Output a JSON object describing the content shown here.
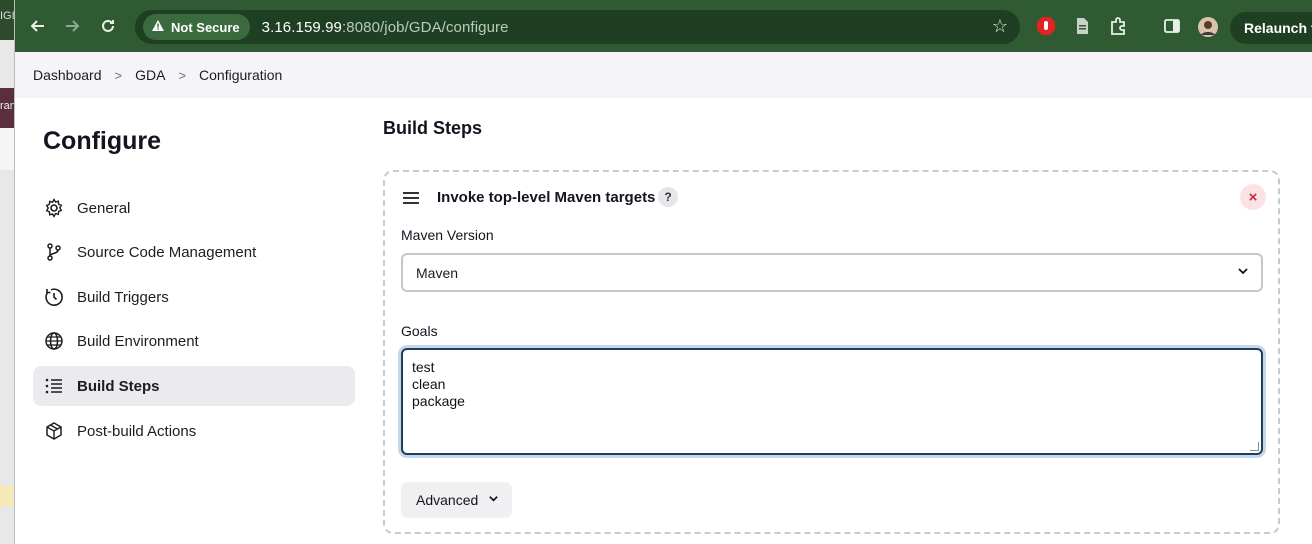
{
  "background_window": {
    "fragment_top": "IGI",
    "fragment_mid": "ran"
  },
  "browser": {
    "security_label": "Not Secure",
    "url_host": "3.16.159.99",
    "url_rest": ":8080/job/GDA/configure",
    "relaunch_label": "Relaunch to"
  },
  "breadcrumb": {
    "items": [
      "Dashboard",
      "GDA",
      "Configuration"
    ],
    "separator": ">"
  },
  "sidebar": {
    "title": "Configure",
    "items": [
      {
        "label": "General",
        "icon": "gear-icon"
      },
      {
        "label": "Source Code Management",
        "icon": "branch-icon"
      },
      {
        "label": "Build Triggers",
        "icon": "timer-icon"
      },
      {
        "label": "Build Environment",
        "icon": "globe-icon"
      },
      {
        "label": "Build Steps",
        "icon": "list-icon",
        "active": true
      },
      {
        "label": "Post-build Actions",
        "icon": "package-icon"
      }
    ]
  },
  "main": {
    "section_title": "Build Steps",
    "step": {
      "title": "Invoke top-level Maven targets",
      "help": "?",
      "close": "×",
      "maven_version_label": "Maven Version",
      "maven_version_value": "Maven",
      "goals_label": "Goals",
      "goals_lines": [
        "test",
        "clean",
        "package"
      ],
      "advanced_label": "Advanced"
    }
  },
  "colors": {
    "chrome_bg": "#2f5a32",
    "active_nav": "#ebebef",
    "close_red": "#d0263a",
    "focus_ring": "#1c3f5e"
  }
}
